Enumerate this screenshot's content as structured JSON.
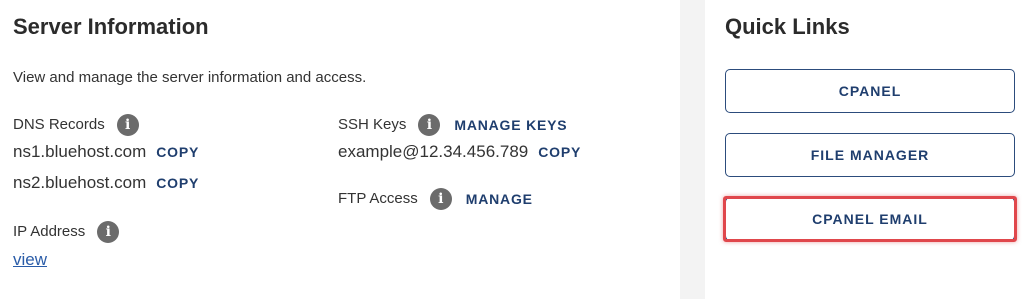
{
  "server_info": {
    "title": "Server Information",
    "description": "View and manage the server information and access.",
    "dns": {
      "label": "DNS Records",
      "records": [
        {
          "value": "ns1.bluehost.com",
          "action": "COPY"
        },
        {
          "value": "ns2.bluehost.com",
          "action": "COPY"
        }
      ]
    },
    "ip": {
      "label": "IP Address",
      "link": "view"
    },
    "ssh": {
      "label": "SSH Keys",
      "action": "MANAGE KEYS",
      "value": "example@12.34.456.789",
      "value_action": "COPY"
    },
    "ftp": {
      "label": "FTP Access",
      "action": "MANAGE"
    }
  },
  "quick_links": {
    "title": "Quick Links",
    "buttons": [
      {
        "label": "CPANEL"
      },
      {
        "label": "FILE MANAGER"
      },
      {
        "label": "CPANEL EMAIL"
      }
    ]
  },
  "icons": {
    "info": "info-icon"
  },
  "colors": {
    "link": "#1f3e6e",
    "highlight": "#e0474c",
    "divider": "#f3f3f3"
  }
}
